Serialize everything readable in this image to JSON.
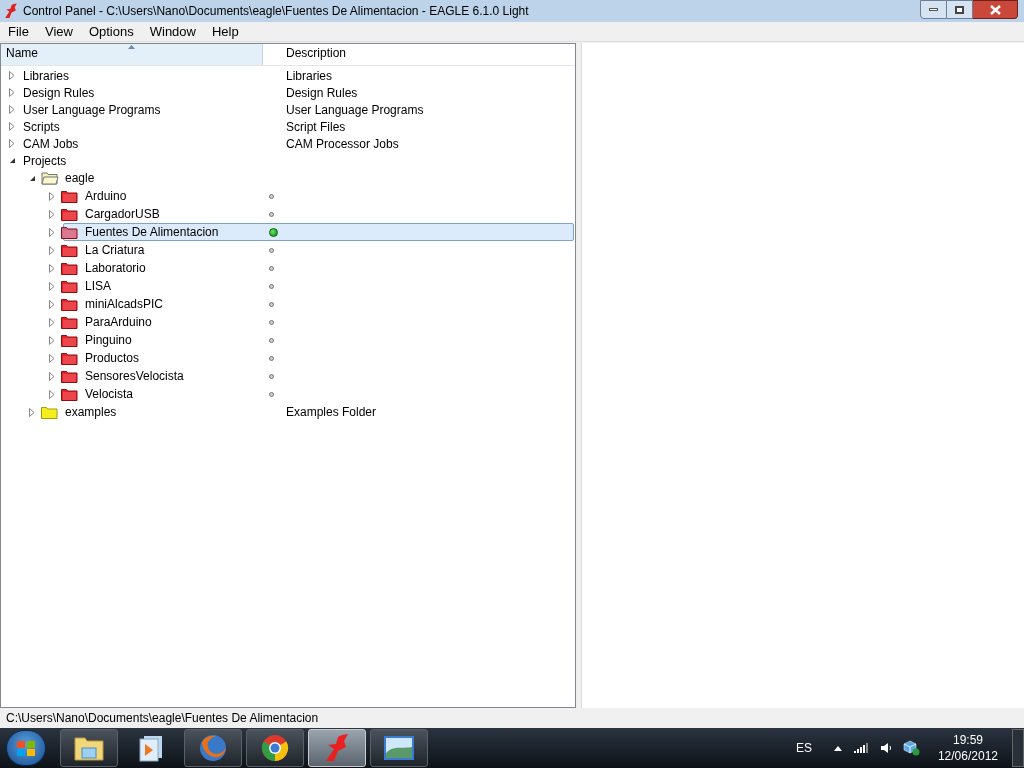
{
  "window": {
    "title": "Control Panel - C:\\Users\\Nano\\Documents\\eagle\\Fuentes De Alimentacion - EAGLE 6.1.0 Light"
  },
  "menu": [
    "File",
    "View",
    "Options",
    "Window",
    "Help"
  ],
  "columns": [
    "Name",
    "Description"
  ],
  "tree": [
    {
      "kind": "category",
      "name": "Libraries",
      "description": "Libraries",
      "expanded": false
    },
    {
      "kind": "category",
      "name": "Design Rules",
      "description": "Design Rules",
      "expanded": false
    },
    {
      "kind": "category",
      "name": "User Language Programs",
      "description": "User Language Programs",
      "expanded": false
    },
    {
      "kind": "category",
      "name": "Scripts",
      "description": "Script Files",
      "expanded": false
    },
    {
      "kind": "category",
      "name": "CAM Jobs",
      "description": "CAM Processor Jobs",
      "expanded": false
    },
    {
      "kind": "category",
      "name": "Projects",
      "expanded": true,
      "children": [
        {
          "kind": "folder",
          "name": "eagle",
          "expanded": true,
          "children": [
            {
              "kind": "project",
              "name": "Arduino",
              "expanded": false,
              "open": false,
              "selected": false
            },
            {
              "kind": "project",
              "name": "CargadorUSB",
              "expanded": false,
              "open": false,
              "selected": false
            },
            {
              "kind": "project",
              "name": "Fuentes De Alimentacion",
              "expanded": false,
              "open": true,
              "selected": true
            },
            {
              "kind": "project",
              "name": "La Criatura",
              "expanded": false,
              "open": false,
              "selected": false
            },
            {
              "kind": "project",
              "name": "Laboratorio",
              "expanded": false,
              "open": false,
              "selected": false
            },
            {
              "kind": "project",
              "name": "LISA",
              "expanded": false,
              "open": false,
              "selected": false
            },
            {
              "kind": "project",
              "name": "miniAlcadsPIC",
              "expanded": false,
              "open": false,
              "selected": false
            },
            {
              "kind": "project",
              "name": "ParaArduino",
              "expanded": false,
              "open": false,
              "selected": false
            },
            {
              "kind": "project",
              "name": "Pinguino",
              "expanded": false,
              "open": false,
              "selected": false
            },
            {
              "kind": "project",
              "name": "Productos",
              "expanded": false,
              "open": false,
              "selected": false
            },
            {
              "kind": "project",
              "name": "SensoresVelocista",
              "expanded": false,
              "open": false,
              "selected": false
            },
            {
              "kind": "project",
              "name": "Velocista",
              "expanded": false,
              "open": false,
              "selected": false
            }
          ]
        },
        {
          "kind": "folder",
          "name": "examples",
          "description": "Examples Folder",
          "expanded": false
        }
      ]
    }
  ],
  "status_bar": "C:\\Users\\Nano\\Documents\\eagle\\Fuentes De Alimentacion",
  "taskbar": {
    "apps": [
      {
        "kind": "explorer",
        "selected": false
      },
      {
        "kind": "media",
        "selected": false
      },
      {
        "kind": "firefox",
        "selected": false
      },
      {
        "kind": "chrome",
        "selected": false
      },
      {
        "kind": "eagle",
        "selected": true
      },
      {
        "kind": "photos",
        "selected": false
      }
    ],
    "language": "ES",
    "time": "19:59",
    "date": "12/06/2012"
  }
}
